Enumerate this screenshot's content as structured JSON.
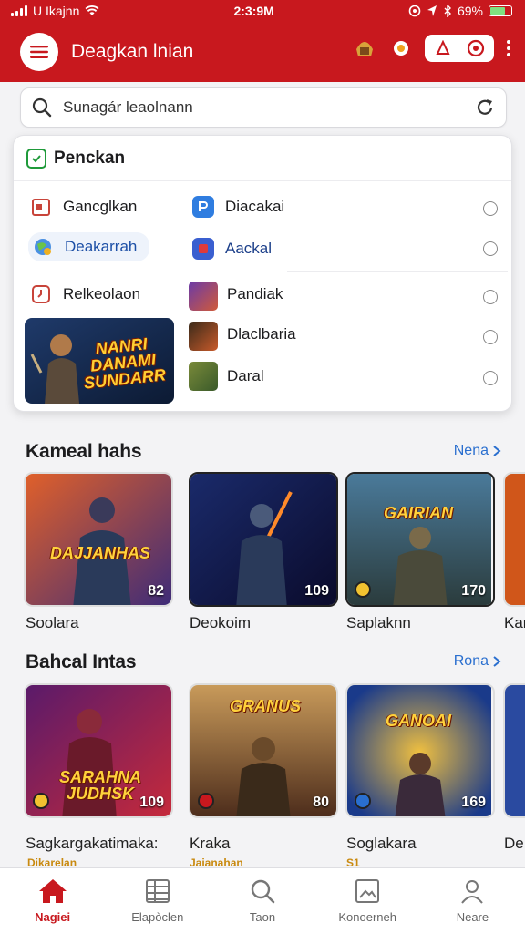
{
  "status": {
    "carrier": "U Ikajnn",
    "time": "2:3:9M",
    "battery": "69%"
  },
  "appbar": {
    "title": "Deagkan lnian"
  },
  "search": {
    "placeholder": "Sunagár leaolnann"
  },
  "panel": {
    "title": "Penckan",
    "left_options": [
      {
        "label": "Gancglkan"
      },
      {
        "label": "Deakarrah"
      },
      {
        "label": "Relkeolaon"
      }
    ],
    "right_options": [
      {
        "label": "Diacakai"
      },
      {
        "label": "Aackal"
      },
      {
        "label": "Pandiak"
      },
      {
        "label": "Dlaclbaria"
      },
      {
        "label": "Daral"
      }
    ],
    "promo_text": "NANRI DANAMI SUNDARR"
  },
  "section1": {
    "title": "Kameal hahs",
    "more": "Nena",
    "cards": [
      {
        "title": "Soolara",
        "count": "82",
        "logo": "DAJJANHAS"
      },
      {
        "title": "Deokoim",
        "count": "109",
        "logo": ""
      },
      {
        "title": "Saplaknn",
        "count": "170",
        "logo": "GAIRIAN"
      },
      {
        "title": "Kar",
        "count": "",
        "logo": ""
      }
    ]
  },
  "section2": {
    "title": "Bahcal Intas",
    "more": "Rona",
    "cards": [
      {
        "title": "Sagkargakatimaka:",
        "count": "109",
        "logo": "SARAHNA JUDHSK",
        "tag": "Dikarelan"
      },
      {
        "title": "Kraka",
        "count": "80",
        "logo": "GRANUS",
        "tag": "Jaianahan"
      },
      {
        "title": "Soglakara",
        "count": "169",
        "logo": "GANOAI",
        "tag": "S1"
      },
      {
        "title": "De",
        "count": "",
        "logo": "",
        "tag": ""
      }
    ]
  },
  "nav": [
    {
      "label": "Nagiei"
    },
    {
      "label": "Elapòclen"
    },
    {
      "label": "Taon"
    },
    {
      "label": "Konoerneh"
    },
    {
      "label": "Neare"
    }
  ],
  "colors": {
    "brand": "#c8181e",
    "link": "#2a6fcf",
    "selected_text": "#1c4fa6"
  }
}
